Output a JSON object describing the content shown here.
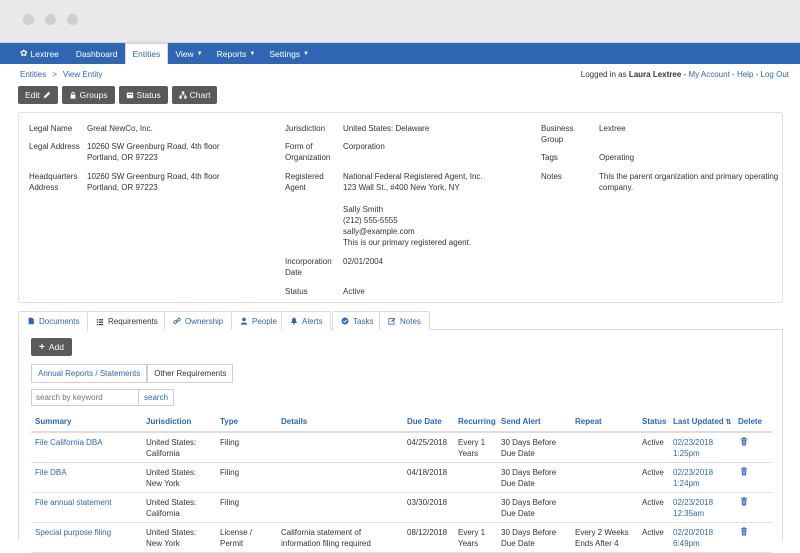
{
  "nav": {
    "brand": "Lextree",
    "items": [
      {
        "label": "Dashboard",
        "active": false,
        "dropdown": false
      },
      {
        "label": "Entities",
        "active": true,
        "dropdown": false
      },
      {
        "label": "View",
        "active": false,
        "dropdown": true
      },
      {
        "label": "Reports",
        "active": false,
        "dropdown": true
      },
      {
        "label": "Settings",
        "active": false,
        "dropdown": true
      }
    ]
  },
  "breadcrumb": {
    "root": "Entities",
    "separator": ">",
    "current": "View Entity"
  },
  "user": {
    "prefix": "Logged in as",
    "name": "Laura Lextree",
    "my_account": "My Account",
    "help": "Help",
    "logout": "Log Out",
    "sep": "-"
  },
  "actions": {
    "edit": "Edit",
    "groups": "Groups",
    "status": "Status",
    "chart": "Chart"
  },
  "entity": {
    "legal_name_label": "Legal Name",
    "legal_name": "Great NewCo, Inc.",
    "legal_address_label": "Legal Address",
    "legal_address_1": "10260 SW Greenburg Road, 4th floor",
    "legal_address_2": "Portland, OR 97223",
    "hq_label_1": "Headquarters",
    "hq_label_2": "Address",
    "hq_address_1": "10260 SW Greenburg Road, 4th floor",
    "hq_address_2": "Portland, OR 97223",
    "jurisdiction_label": "Jurisdiction",
    "jurisdiction": "United States: Delaware",
    "form_label_1": "Form of",
    "form_label_2": "Organization",
    "form": "Corporation",
    "agent_label_1": "Registered",
    "agent_label_2": "Agent",
    "agent_1": "National Federal Registered Agent, Inc.",
    "agent_2": "123 Wall St., #400 New York, NY",
    "agent_contact": "Sally Smith",
    "agent_phone": "(212) 555-5555",
    "agent_email": "sally@example.com",
    "agent_note": "This is our primary registered agent.",
    "inc_label_1": "Incorporation",
    "inc_label_2": "Date",
    "inc_date": "02/01/2004",
    "status_label": "Status",
    "status": "Active",
    "bg_label_1": "Business",
    "bg_label_2": "Group",
    "business_group": "Lextree",
    "tags_label": "Tags",
    "tags": "Operating",
    "notes_label": "Notes",
    "notes_1": "This the parent organization and primary operating",
    "notes_2": "company."
  },
  "tabs": [
    {
      "label": "Documents",
      "icon": "file-icon",
      "active": false
    },
    {
      "label": "Requirements",
      "icon": "list-icon",
      "active": true
    },
    {
      "label": "Ownership",
      "icon": "link-icon",
      "active": false
    },
    {
      "label": "People",
      "icon": "user-icon",
      "active": false
    },
    {
      "label": "Alerts",
      "icon": "bell-icon",
      "active": false
    },
    {
      "label": "Tasks",
      "icon": "check-circle-icon",
      "active": false
    },
    {
      "label": "Notes",
      "icon": "edit-icon",
      "active": false
    }
  ],
  "requirements": {
    "add": "Add",
    "subtab_annual": "Annual Reports / Statements",
    "subtab_other": "Other Requirements",
    "search_placeholder": "search by keyword",
    "search_button": "search",
    "columns": {
      "summary": "Summary",
      "jurisdiction": "Jurisdiction",
      "type": "Type",
      "details": "Details",
      "due": "Due Date",
      "recurring": "Recurring",
      "alert": "Send Alert",
      "repeat": "Repeat",
      "status": "Status",
      "updated": "Last Updated",
      "delete": "Delete"
    },
    "rows": [
      {
        "summary": "File California DBA",
        "jur_1": "United States:",
        "jur_2": "California",
        "type_1": "Filing",
        "type_2": "",
        "details_1": "",
        "details_2": "",
        "due": "04/25/2018",
        "rec_1": "Every 1",
        "rec_2": "Years",
        "alert_1": "30 Days Before",
        "alert_2": "Due Date",
        "rep_1": "",
        "rep_2": "",
        "status": "Active",
        "upd_1": "02/23/2018",
        "upd_2": "1:25pm"
      },
      {
        "summary": "File DBA",
        "jur_1": "United States:",
        "jur_2": "New York",
        "type_1": "Filing",
        "type_2": "",
        "details_1": "",
        "details_2": "",
        "due": "04/18/2018",
        "rec_1": "",
        "rec_2": "",
        "alert_1": "30 Days Before",
        "alert_2": "Due Date",
        "rep_1": "",
        "rep_2": "",
        "status": "Active",
        "upd_1": "02/23/2018",
        "upd_2": "1:24pm"
      },
      {
        "summary": "File annual statement",
        "jur_1": "United States:",
        "jur_2": "California",
        "type_1": "Filing",
        "type_2": "",
        "details_1": "",
        "details_2": "",
        "due": "03/30/2018",
        "rec_1": "",
        "rec_2": "",
        "alert_1": "30 Days Before",
        "alert_2": "Due Date",
        "rep_1": "",
        "rep_2": "",
        "status": "Active",
        "upd_1": "02/23/2018",
        "upd_2": "12:35am"
      },
      {
        "summary": "Special purpose filing",
        "jur_1": "United States:",
        "jur_2": "New York",
        "type_1": "License /",
        "type_2": "Permit",
        "details_1": "California statement of",
        "details_2": "information filing required",
        "due": "08/12/2018",
        "rec_1": "Every 1",
        "rec_2": "Years",
        "alert_1": "30 Days Before",
        "alert_2": "Due Date",
        "rep_1": "Every 2 Weeks",
        "rep_2": "Ends After 4",
        "status": "Active",
        "upd_1": "02/20/2018",
        "upd_2": "6:49pm"
      }
    ]
  }
}
